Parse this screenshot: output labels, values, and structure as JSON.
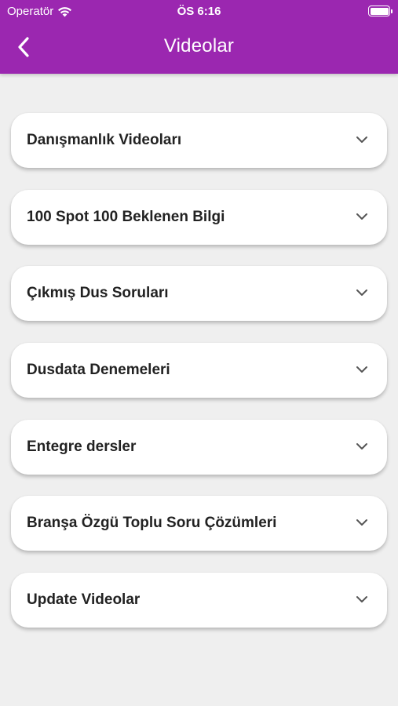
{
  "status_bar": {
    "carrier": "Operatör",
    "time": "ÖS 6:16"
  },
  "nav": {
    "title": "Videolar",
    "back_icon": "chevron-left-icon"
  },
  "categories": [
    {
      "label": "Danışmanlık Videoları"
    },
    {
      "label": "100 Spot 100 Beklenen Bilgi"
    },
    {
      "label": "Çıkmış Dus Soruları"
    },
    {
      "label": "Dusdata Denemeleri"
    },
    {
      "label": "Entegre dersler"
    },
    {
      "label": "Branşa Özgü Toplu Soru Çözümleri"
    },
    {
      "label": "Update Videolar"
    }
  ],
  "colors": {
    "header": "#9b27b0",
    "background": "#efefef",
    "card": "#ffffff",
    "text": "#222222",
    "chevron": "#555555"
  }
}
